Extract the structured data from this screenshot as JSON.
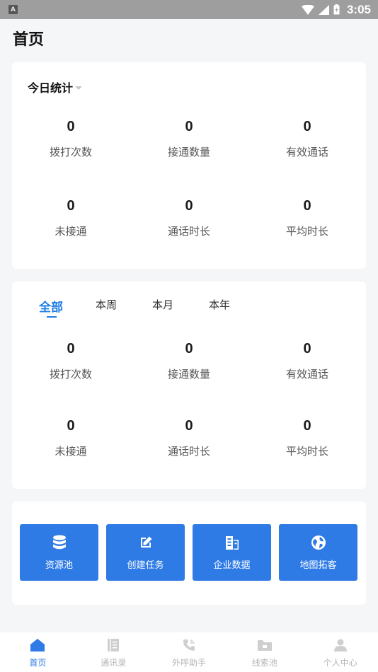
{
  "status_bar": {
    "time": "3:05",
    "notification_icon": "A"
  },
  "page": {
    "title": "首页"
  },
  "today_stats": {
    "title": "今日统计",
    "items": [
      {
        "value": "0",
        "label": "拨打次数"
      },
      {
        "value": "0",
        "label": "接通数量"
      },
      {
        "value": "0",
        "label": "有效通话"
      },
      {
        "value": "0",
        "label": "未接通"
      },
      {
        "value": "0",
        "label": "通话时长"
      },
      {
        "value": "0",
        "label": "平均时长"
      }
    ]
  },
  "period_stats": {
    "tabs": [
      {
        "label": "全部",
        "active": true
      },
      {
        "label": "本周",
        "active": false
      },
      {
        "label": "本月",
        "active": false
      },
      {
        "label": "本年",
        "active": false
      }
    ],
    "items": [
      {
        "value": "0",
        "label": "拨打次数"
      },
      {
        "value": "0",
        "label": "接通数量"
      },
      {
        "value": "0",
        "label": "有效通话"
      },
      {
        "value": "0",
        "label": "未接通"
      },
      {
        "value": "0",
        "label": "通话时长"
      },
      {
        "value": "0",
        "label": "平均时长"
      }
    ]
  },
  "quick_actions": [
    {
      "label": "资源池",
      "icon": "database-icon"
    },
    {
      "label": "创建任务",
      "icon": "edit-icon"
    },
    {
      "label": "企业数据",
      "icon": "building-icon"
    },
    {
      "label": "地图拓客",
      "icon": "globe-icon"
    }
  ],
  "tab_bar": [
    {
      "label": "首页",
      "icon": "home-icon",
      "active": true
    },
    {
      "label": "通讯录",
      "icon": "contacts-icon",
      "active": false
    },
    {
      "label": "外呼助手",
      "icon": "phone-icon",
      "active": false
    },
    {
      "label": "线索池",
      "icon": "folder-icon",
      "active": false
    },
    {
      "label": "个人中心",
      "icon": "user-icon",
      "active": false
    }
  ],
  "colors": {
    "accent": "#2f7be6",
    "tab_active": "#1e7ee6",
    "inactive": "#b4b4b4",
    "background": "#f5f6f8"
  }
}
